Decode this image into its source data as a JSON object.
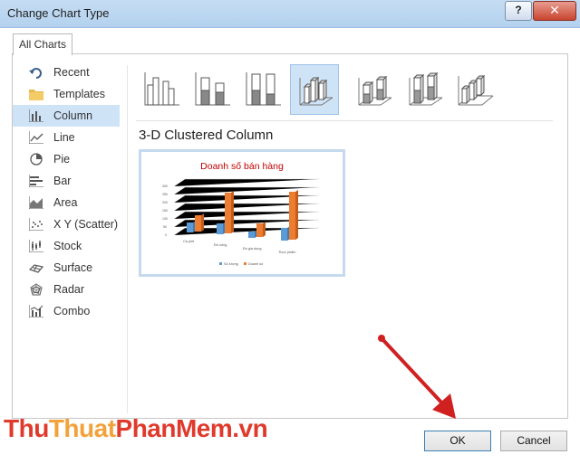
{
  "window": {
    "title": "Change Chart Type",
    "help_label": "?",
    "close_label": "✕"
  },
  "tabs": [
    {
      "label": "All Charts"
    }
  ],
  "sidebar": {
    "items": [
      {
        "label": "Recent",
        "icon": "recent-icon"
      },
      {
        "label": "Templates",
        "icon": "folder-icon"
      },
      {
        "label": "Column",
        "icon": "column-chart-icon",
        "selected": true
      },
      {
        "label": "Line",
        "icon": "line-chart-icon"
      },
      {
        "label": "Pie",
        "icon": "pie-chart-icon"
      },
      {
        "label": "Bar",
        "icon": "bar-chart-icon"
      },
      {
        "label": "Area",
        "icon": "area-chart-icon"
      },
      {
        "label": "X Y (Scatter)",
        "icon": "scatter-chart-icon"
      },
      {
        "label": "Stock",
        "icon": "stock-chart-icon"
      },
      {
        "label": "Surface",
        "icon": "surface-chart-icon"
      },
      {
        "label": "Radar",
        "icon": "radar-chart-icon"
      },
      {
        "label": "Combo",
        "icon": "combo-chart-icon"
      }
    ]
  },
  "subtypes": {
    "selected_index": 3,
    "title": "3-D Clustered Column"
  },
  "preview": {
    "chart_title": "Doanh số bán hàng",
    "categories": [
      "Cà phê",
      "Đồ uống",
      "Đồ gia dụng",
      "Thực phẩm"
    ],
    "series": [
      {
        "name": "Số lượng",
        "color": "#5b9bd5"
      },
      {
        "name": "Doanh số",
        "color": "#ed7d31"
      }
    ]
  },
  "buttons": {
    "ok": "OK",
    "cancel": "Cancel"
  },
  "watermark": {
    "part1": "Thu",
    "part2": "Thuat",
    "part3": "PhanMem.vn"
  },
  "colors": {
    "selection": "#cfe3f7",
    "title_bar": "#b3d1ee",
    "close": "#c9452f",
    "arrow": "#d02020"
  }
}
